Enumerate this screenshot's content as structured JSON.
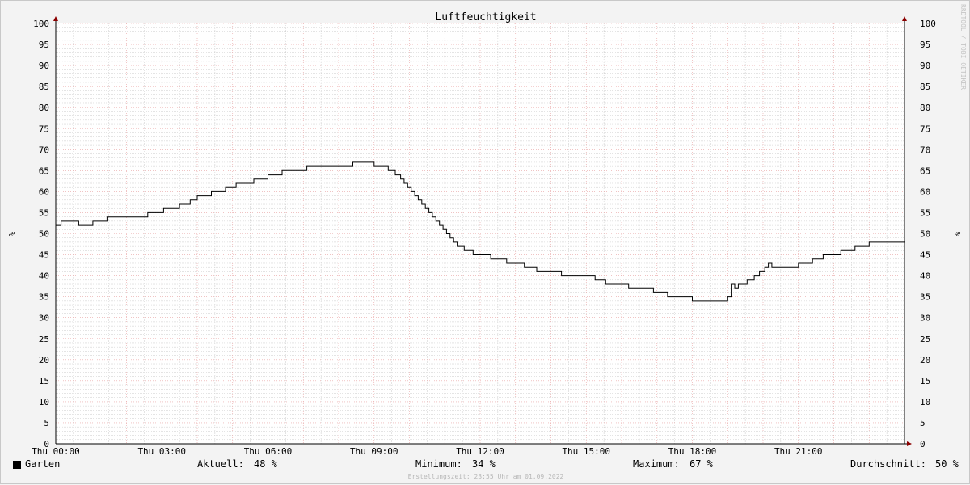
{
  "credit": "RRDTOOL / TOBI OETIKER",
  "footer": "Erstellungszeit: 23:55 Uhr am 01.09.2022",
  "legend": {
    "series_name": "Garten",
    "aktuell_label": "Aktuell:",
    "aktuell_value": "48 %",
    "minimum_label": "Minimum:",
    "minimum_value": "34 %",
    "maximum_label": "Maximum:",
    "maximum_value": "67 %",
    "durchschnitt_label": "Durchschnitt:",
    "durchschnitt_value": "50 %"
  },
  "colors": {
    "background": "#f3f3f3",
    "plot_background": "#ffffff",
    "major_grid": "#e8a0a0",
    "minor_grid": "#c8c8c8",
    "axis": "#8b0000",
    "line": "#000000"
  },
  "chart_data": {
    "type": "line",
    "title": "Luftfeuchtigkeit",
    "ylabel": "%",
    "ylim": [
      0,
      100
    ],
    "ytick_step": 5,
    "xlim": [
      0,
      24
    ],
    "xtick_hours": [
      0,
      3,
      6,
      9,
      12,
      15,
      18,
      21
    ],
    "xtick_labels": [
      "Thu 00:00",
      "Thu 03:00",
      "Thu 06:00",
      "Thu 09:00",
      "Thu 12:00",
      "Thu 15:00",
      "Thu 18:00",
      "Thu 21:00"
    ],
    "grid": true,
    "series": [
      {
        "name": "Garten",
        "step": true,
        "x": [
          0.0,
          0.15,
          0.65,
          1.05,
          1.45,
          2.5,
          2.6,
          3.05,
          3.5,
          3.8,
          4.0,
          4.4,
          4.8,
          5.1,
          5.6,
          6.0,
          6.4,
          7.1,
          8.4,
          9.0,
          9.2,
          9.4,
          9.6,
          9.75,
          9.85,
          9.95,
          10.05,
          10.15,
          10.25,
          10.35,
          10.45,
          10.55,
          10.65,
          10.75,
          10.85,
          10.95,
          11.05,
          11.15,
          11.25,
          11.35,
          11.55,
          11.8,
          12.3,
          12.75,
          13.25,
          13.6,
          14.3,
          15.25,
          15.55,
          16.2,
          16.9,
          17.3,
          18.0,
          19.0,
          19.1,
          19.2,
          19.3,
          19.55,
          19.75,
          19.9,
          20.05,
          20.15,
          20.25,
          20.4,
          20.5,
          20.65,
          21.0,
          21.4,
          21.7,
          22.2,
          22.6,
          23.0,
          23.3,
          24.0
        ],
        "y": [
          52,
          53,
          52,
          53,
          54,
          54,
          55,
          56,
          57,
          58,
          59,
          60,
          61,
          62,
          63,
          64,
          65,
          66,
          67,
          66,
          66,
          65,
          64,
          63,
          62,
          61,
          60,
          59,
          58,
          57,
          56,
          55,
          54,
          53,
          52,
          51,
          50,
          49,
          48,
          47,
          46,
          45,
          44,
          43,
          42,
          41,
          40,
          39,
          38,
          37,
          36,
          35,
          34,
          35,
          38,
          37,
          38,
          39,
          40,
          41,
          42,
          43,
          42,
          42,
          42,
          42,
          43,
          44,
          45,
          46,
          47,
          48,
          48,
          48
        ]
      }
    ]
  }
}
